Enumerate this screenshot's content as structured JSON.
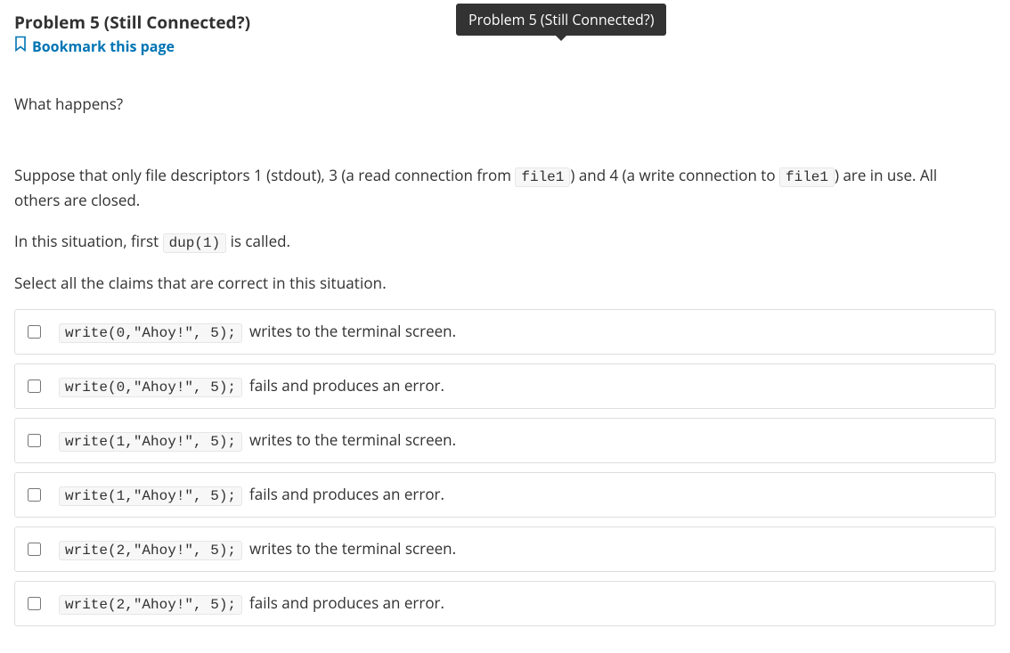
{
  "tooltip": "Problem 5 (Still Connected?)",
  "title": "Problem 5 (Still Connected?)",
  "bookmark_label": "Bookmark this page",
  "question_heading": "What happens?",
  "para1_pre": "Suppose that only file descriptors 1 (stdout), 3 (a read connection from ",
  "para1_code1": "file1",
  "para1_mid": ") and 4 (a write connection to ",
  "para1_code2": "file1",
  "para1_post": ") are in use. All others are closed.",
  "para2_pre": "In this situation, first ",
  "para2_code": "dup(1)",
  "para2_post": " is called.",
  "instruction": "Select all the claims that are correct in this situation.",
  "options": [
    {
      "code": "write(0,\"Ahoy!\", 5);",
      "text": "writes to the terminal screen."
    },
    {
      "code": "write(0,\"Ahoy!\", 5);",
      "text": "fails and produces an error."
    },
    {
      "code": "write(1,\"Ahoy!\", 5);",
      "text": "writes to the terminal screen."
    },
    {
      "code": "write(1,\"Ahoy!\", 5);",
      "text": "fails and produces an error."
    },
    {
      "code": "write(2,\"Ahoy!\", 5);",
      "text": "writes to the terminal screen."
    },
    {
      "code": "write(2,\"Ahoy!\", 5);",
      "text": "fails and produces an error."
    }
  ]
}
